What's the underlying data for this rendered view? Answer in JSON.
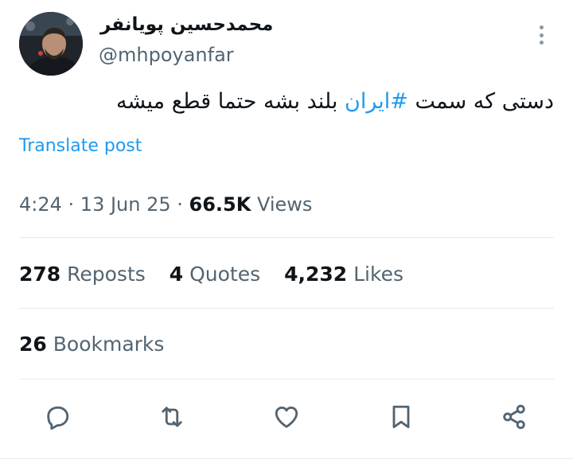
{
  "author": {
    "display_name": "محمدحسین پویانفر",
    "handle": "@mhpoyanfar"
  },
  "tweet": {
    "text_before": "دستی که سمت ",
    "hashtag": "#ایران",
    "text_after": " بلند بشه حتما قطع میشه"
  },
  "translate_label": "Translate post",
  "meta": {
    "time": "4:24",
    "sep1": " · ",
    "date": "13 Jun 25",
    "sep2": " · ",
    "views_count": "66.5K",
    "views_label": " Views"
  },
  "stats": {
    "reposts_count": "278",
    "reposts_label": " Reposts",
    "quotes_count": "4",
    "quotes_label": " Quotes",
    "likes_count": "4,232",
    "likes_label": " Likes"
  },
  "bookmarks": {
    "count": "26",
    "label": " Bookmarks"
  },
  "icons": {
    "reply": "reply-icon",
    "repost": "repost-icon",
    "like": "like-icon",
    "bookmark": "bookmark-icon",
    "share": "share-icon",
    "more": "more-icon"
  },
  "colors": {
    "accent": "#1d9bf0",
    "text": "#0f1419",
    "secondary": "#536471",
    "divider": "#e6e9eb"
  }
}
